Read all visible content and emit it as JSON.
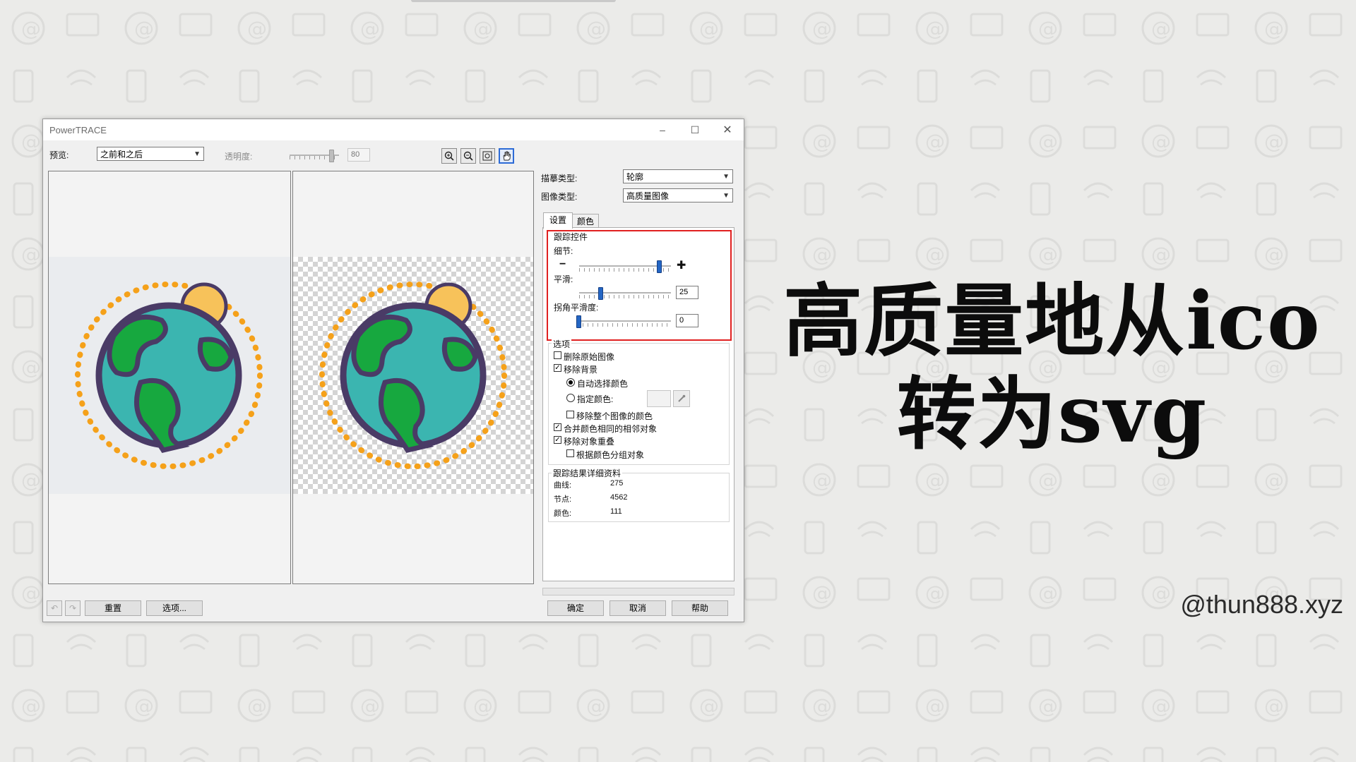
{
  "window": {
    "title": "PowerTRACE"
  },
  "preview": {
    "label": "预览:",
    "value": "之前和之后",
    "transparency_label": "透明度:",
    "transparency_value": "80"
  },
  "trace": {
    "type_label": "描摹类型:",
    "type_value": "轮廓",
    "image_type_label": "图像类型:",
    "image_type_value": "高质量图像"
  },
  "tabs": [
    {
      "label": "设置"
    },
    {
      "label": "颜色"
    }
  ],
  "trace_controls": {
    "title": "跟踪控件",
    "detail_label": "细节:",
    "detail_level": 0.87,
    "smoothing_label": "平滑:",
    "smoothing_value": "25",
    "corner_label": "拐角平滑度:",
    "corner_value": "0"
  },
  "options": {
    "title": "选项",
    "delete_original": "删除原始图像",
    "remove_background": "移除背景",
    "auto_color": "自动选择颜色",
    "specify_color": "指定颜色:",
    "remove_whole": "移除整个图像的颜色",
    "merge_adjacent": "合并颜色相同的相邻对象",
    "remove_overlap": "移除对象重叠",
    "group_by_color": "根据颜色分组对象"
  },
  "details": {
    "title": "跟踪结果详细资料",
    "curves_label": "曲线:",
    "curves_value": "275",
    "nodes_label": "节点:",
    "nodes_value": "4562",
    "colors_label": "颜色:",
    "colors_value": "111"
  },
  "buttons": {
    "reset": "重置",
    "options": "选项...",
    "ok": "确定",
    "cancel": "取消",
    "help": "帮助"
  },
  "headline": {
    "line1": "高质量地从ico",
    "line2": "转为svg"
  },
  "watermark": "@thun888.xyz",
  "colors": {
    "accent_red": "#e02020",
    "globe_ocean": "#3bb5b0",
    "globe_land": "#17a83f",
    "outline": "#4a3b66",
    "sun": "#f7c25a",
    "dots": "#f5a11a"
  }
}
